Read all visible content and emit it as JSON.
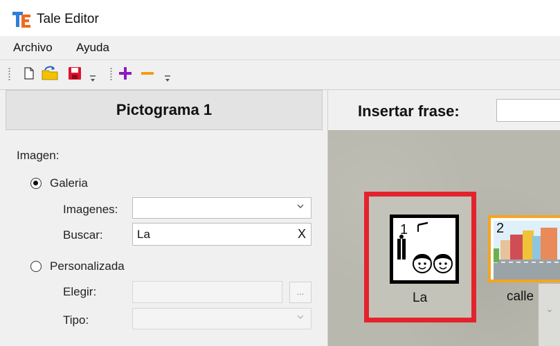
{
  "window": {
    "title": "Tale Editor",
    "app_icon": "te-logo-icon"
  },
  "menu": {
    "items": [
      "Archivo",
      "Ayuda"
    ]
  },
  "toolbar": {
    "buttons": [
      "new-file-icon",
      "open-folder-icon",
      "save-icon",
      "toolbar-overflow-icon",
      "add-icon",
      "remove-icon",
      "toolbar-overflow-icon"
    ],
    "colors": {
      "save": "#e0122b",
      "add": "#8a1bbf",
      "remove": "#f39c12",
      "open": "#f2c200"
    }
  },
  "left_panel": {
    "header": "Pictograma 1",
    "image_label": "Imagen:",
    "galeria": {
      "label": "Galeria",
      "selected": true,
      "imagenes_label": "Imagenes:",
      "imagenes_value": "",
      "buscar_label": "Buscar:",
      "buscar_value": "La",
      "clear_label": "X"
    },
    "personalizada": {
      "label": "Personalizada",
      "selected": false,
      "elegir_label": "Elegir:",
      "elegir_value": "",
      "browse_label": "...",
      "tipo_label": "Tipo:",
      "tipo_value": ""
    }
  },
  "right_panel": {
    "insert_label": "Insertar frase:",
    "insert_value": "",
    "cards": [
      {
        "number": "1",
        "caption": "La",
        "border_color": "#e3232c",
        "selected": true
      },
      {
        "number": "2",
        "caption": "calle",
        "border_color": "#f5a51e",
        "selected": false
      }
    ]
  }
}
